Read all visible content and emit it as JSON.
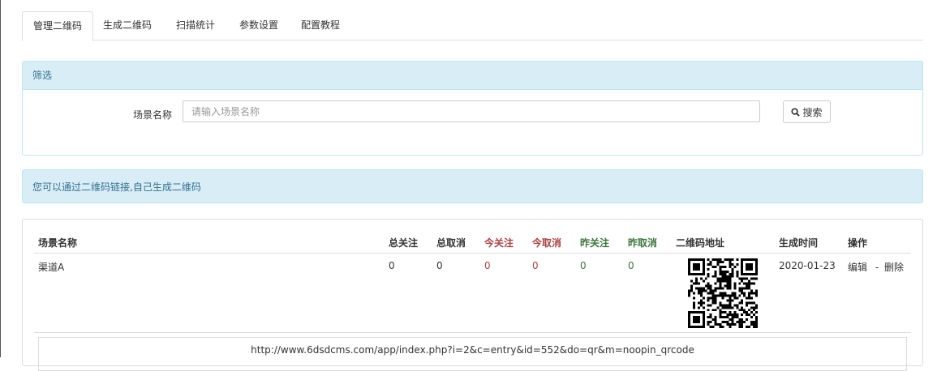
{
  "tabs": [
    {
      "label": "管理二维码",
      "active": true
    },
    {
      "label": "生成二维码",
      "active": false
    },
    {
      "label": "扫描统计",
      "active": false
    },
    {
      "label": "参数设置",
      "active": false
    },
    {
      "label": "配置教程",
      "active": false
    }
  ],
  "filter": {
    "title": "筛选",
    "scene_label": "场景名称",
    "placeholder": "请输入场景名称",
    "search_label": "搜索"
  },
  "info": {
    "text": "您可以通过二维码链接,自己生成二维码"
  },
  "table": {
    "headers": {
      "name": "场景名称",
      "total_follow": "总关注",
      "total_cancel": "总取消",
      "today_follow": "今关注",
      "today_cancel": "今取消",
      "yesterday_follow": "昨关注",
      "yesterday_cancel": "昨取消",
      "qr_url": "二维码地址",
      "created": "生成时间",
      "actions": "操作"
    },
    "rows": [
      {
        "name": "渠道A",
        "total_follow": "0",
        "total_cancel": "0",
        "today_follow": "0",
        "today_cancel": "0",
        "yesterday_follow": "0",
        "yesterday_cancel": "0",
        "created": "2020-01-23",
        "edit": "编辑",
        "separator": "-",
        "delete": "删除",
        "url": "http://www.6dsdcms.com/app/index.php?i=2&c=entry&id=552&do=qr&m=noopin_qrcode"
      }
    ]
  },
  "icons": {
    "search": "search-icon",
    "qr": "qr-code-image"
  },
  "colors": {
    "info_bg": "#d9edf7",
    "info_text": "#31708f",
    "red_header": "#a94442",
    "green_header": "#3c763d"
  }
}
